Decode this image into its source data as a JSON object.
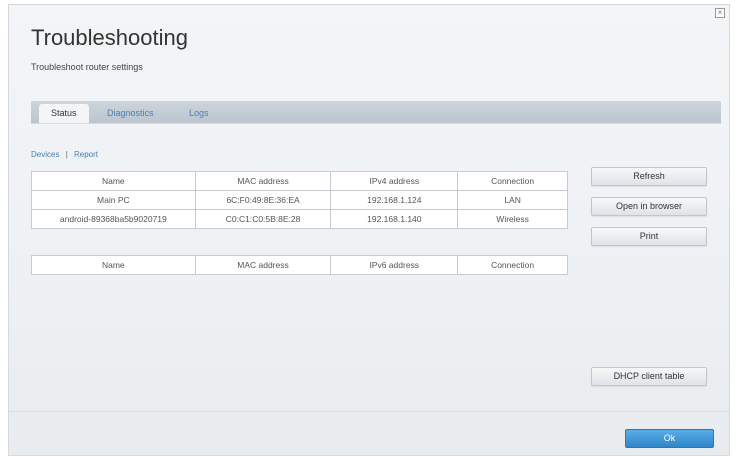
{
  "header": {
    "title": "Troubleshooting",
    "subtitle": "Troubleshoot router settings"
  },
  "tabs": [
    {
      "label": "Status",
      "active": true
    },
    {
      "label": "Diagnostics",
      "active": false
    },
    {
      "label": "Logs",
      "active": false
    }
  ],
  "subnav": {
    "devices": "Devices",
    "separator": "|",
    "report": "Report"
  },
  "ipv4_table": {
    "headers": [
      "Name",
      "MAC address",
      "IPv4 address",
      "Connection"
    ],
    "rows": [
      [
        "Main PC",
        "6C:F0:49:8E:36:EA",
        "192.168.1.124",
        "LAN"
      ],
      [
        "android-89368ba5b9020719",
        "C0:C1:C0:5B:8E:28",
        "192.168.1.140",
        "Wireless"
      ]
    ]
  },
  "ipv6_table": {
    "headers": [
      "Name",
      "MAC address",
      "IPv6 address",
      "Connection"
    ]
  },
  "buttons": {
    "refresh": "Refresh",
    "open_in_browser": "Open in browser",
    "print": "Print",
    "dhcp_client_table": "DHCP client table",
    "ok": "Ok",
    "close": "×"
  },
  "colors": {
    "accent": "#2f86c8",
    "link": "#4a7fb5"
  }
}
